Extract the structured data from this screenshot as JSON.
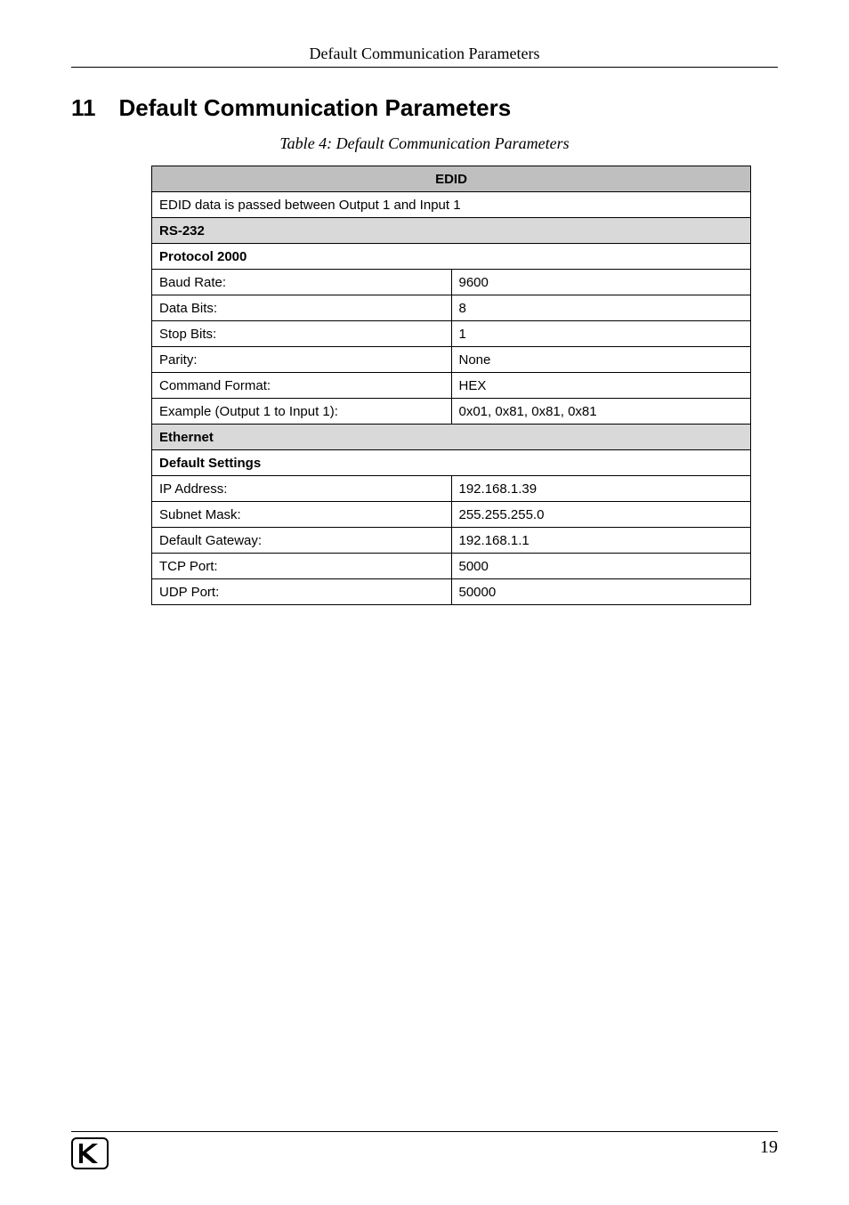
{
  "running_head": "Default Communication Parameters",
  "section": {
    "number": "11",
    "title": "Default Communication Parameters"
  },
  "table_caption": "Table 4: Default Communication Parameters",
  "table": {
    "edid_header": "EDID",
    "edid_note": "EDID data is passed between Output 1 and Input 1",
    "rs232_header": "RS-232",
    "protocol_header": "Protocol 2000",
    "rs232_rows": [
      {
        "label": "Baud Rate:",
        "value": "9600"
      },
      {
        "label": "Data Bits:",
        "value": "8"
      },
      {
        "label": "Stop Bits:",
        "value": "1"
      },
      {
        "label": "Parity:",
        "value": "None"
      },
      {
        "label": "Command Format:",
        "value": "HEX"
      },
      {
        "label": "Example (Output 1 to Input 1):",
        "value": "0x01, 0x81, 0x81, 0x81"
      }
    ],
    "ethernet_header": "Ethernet",
    "default_settings_header": "Default Settings",
    "ethernet_rows": [
      {
        "label": "IP Address:",
        "value": "192.168.1.39"
      },
      {
        "label": "Subnet Mask:",
        "value": "255.255.255.0"
      },
      {
        "label": "Default Gateway:",
        "value": "192.168.1.1"
      },
      {
        "label": "TCP Port:",
        "value": "5000"
      },
      {
        "label": "UDP Port:",
        "value": "50000"
      }
    ]
  },
  "page_number": "19"
}
